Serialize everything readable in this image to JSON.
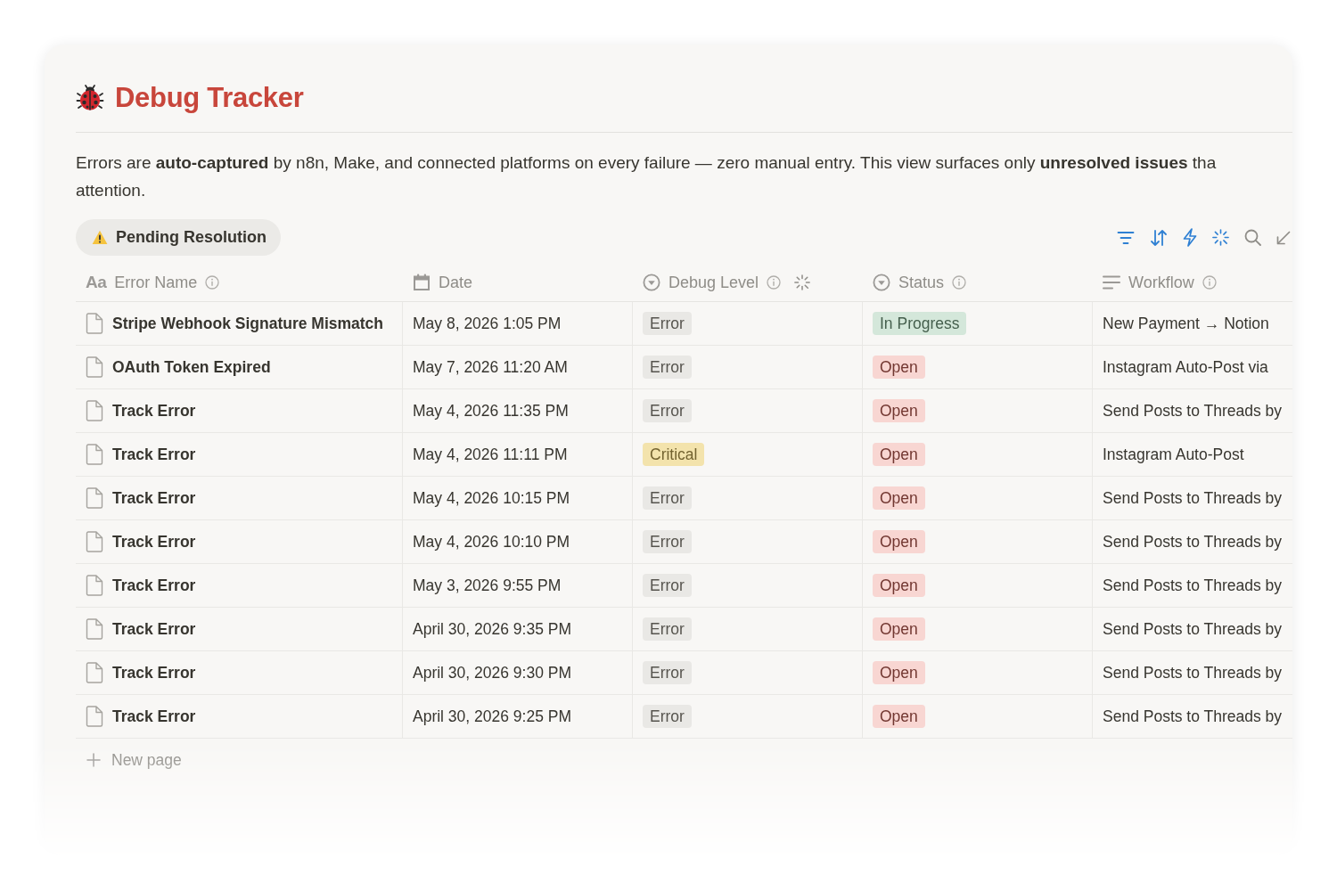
{
  "page_title": "Debug Tracker",
  "description": [
    "Errors are **auto-captured** by n8n, Make, and connected platforms on every failure — zero manual entry. This view surfaces only **unresolved issues** tha",
    "attention."
  ],
  "views": [
    {
      "label": "Pending Resolution",
      "selected": true
    }
  ],
  "table": {
    "columns": [
      {
        "label": "Error Name",
        "kind": "title",
        "glyph": "Aa",
        "info": true,
        "autofill": false
      },
      {
        "label": "Date",
        "kind": "date",
        "info": false,
        "autofill": false
      },
      {
        "label": "Debug Level",
        "kind": "select",
        "info": true,
        "autofill": true
      },
      {
        "label": "Status",
        "kind": "status",
        "info": true,
        "autofill": false
      },
      {
        "label": "Workflow",
        "kind": "text",
        "info": true,
        "autofill": false
      }
    ],
    "rows": [
      {
        "name": "Stripe Webhook Signature Mismatch",
        "date": "May 8, 2026 1:05 PM",
        "debug_level": {
          "label": "Error",
          "color": "#e9e8e5"
        },
        "status": {
          "label": "In Progress",
          "color": "#d4e7da"
        },
        "workflow": "New Payment → Notion"
      },
      {
        "name": "OAuth Token Expired",
        "date": "May 7, 2026 11:20 AM",
        "debug_level": {
          "label": "Error",
          "color": "#e9e8e5"
        },
        "status": {
          "label": "Open",
          "color": "#f8d6d2"
        },
        "workflow": "Instagram Auto-Post via"
      },
      {
        "name": "Track Error",
        "date": "May 4, 2026 11:35 PM",
        "debug_level": {
          "label": "Error",
          "color": "#e9e8e5"
        },
        "status": {
          "label": "Open",
          "color": "#f8d6d2"
        },
        "workflow": "Send Posts to Threads by"
      },
      {
        "name": "Track Error",
        "date": "May 4, 2026 11:11 PM",
        "debug_level": {
          "label": "Critical",
          "color": "#f3e3ac"
        },
        "status": {
          "label": "Open",
          "color": "#f8d6d2"
        },
        "workflow": "Instagram Auto-Post"
      },
      {
        "name": "Track Error",
        "date": "May 4, 2026 10:15 PM",
        "debug_level": {
          "label": "Error",
          "color": "#e9e8e5"
        },
        "status": {
          "label": "Open",
          "color": "#f8d6d2"
        },
        "workflow": "Send Posts to Threads by"
      },
      {
        "name": "Track Error",
        "date": "May 4, 2026 10:10 PM",
        "debug_level": {
          "label": "Error",
          "color": "#e9e8e5"
        },
        "status": {
          "label": "Open",
          "color": "#f8d6d2"
        },
        "workflow": "Send Posts to Threads by"
      },
      {
        "name": "Track Error",
        "date": "May 3, 2026 9:55 PM",
        "debug_level": {
          "label": "Error",
          "color": "#e9e8e5"
        },
        "status": {
          "label": "Open",
          "color": "#f8d6d2"
        },
        "workflow": "Send Posts to Threads by"
      },
      {
        "name": "Track Error",
        "date": "April 30, 2026 9:35 PM",
        "debug_level": {
          "label": "Error",
          "color": "#e9e8e5"
        },
        "status": {
          "label": "Open",
          "color": "#f8d6d2"
        },
        "workflow": "Send Posts to Threads by"
      },
      {
        "name": "Track Error",
        "date": "April 30, 2026 9:30 PM",
        "debug_level": {
          "label": "Error",
          "color": "#e9e8e5"
        },
        "status": {
          "label": "Open",
          "color": "#f8d6d2"
        },
        "workflow": "Send Posts to Threads by"
      },
      {
        "name": "Track Error",
        "date": "April 30, 2026 9:25 PM",
        "debug_level": {
          "label": "Error",
          "color": "#e9e8e5"
        },
        "status": {
          "label": "Open",
          "color": "#f8d6d2"
        },
        "workflow": "Send Posts to Threads by"
      }
    ]
  },
  "new_row": "New page"
}
